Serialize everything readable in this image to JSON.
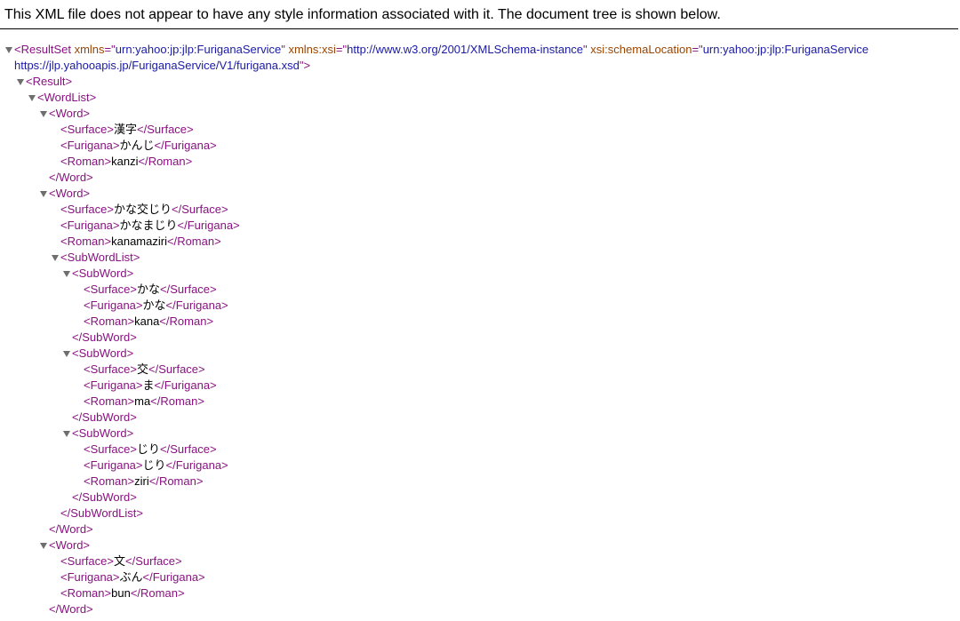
{
  "header": {
    "notice": "This XML file does not appear to have any style information associated with it. The document tree is shown below."
  },
  "root": {
    "tag": "ResultSet",
    "attrs": [
      {
        "name": "xmlns",
        "value": "urn:yahoo:jp:jlp:FuriganaService"
      },
      {
        "name": "xmlns:xsi",
        "value": "http://www.w3.org/2001/XMLSchema-instance"
      },
      {
        "name": "xsi:schemaLocation",
        "value": "urn:yahoo:jp:jlp:FuriganaService https://jlp.yahooapis.jp/FuriganaService/V1/furigana.xsd"
      }
    ]
  },
  "lines": [
    {
      "type": "open",
      "tag": "Result",
      "depth": 1,
      "toggle": true
    },
    {
      "type": "open",
      "tag": "WordList",
      "depth": 2,
      "toggle": true
    },
    {
      "type": "open",
      "tag": "Word",
      "depth": 3,
      "toggle": true
    },
    {
      "type": "leaf",
      "tag": "Surface",
      "text": "漢字",
      "depth": 4
    },
    {
      "type": "leaf",
      "tag": "Furigana",
      "text": "かんじ",
      "depth": 4
    },
    {
      "type": "leaf",
      "tag": "Roman",
      "text": "kanzi",
      "depth": 4
    },
    {
      "type": "close",
      "tag": "Word",
      "depth": 3
    },
    {
      "type": "open",
      "tag": "Word",
      "depth": 3,
      "toggle": true
    },
    {
      "type": "leaf",
      "tag": "Surface",
      "text": "かな交じり",
      "depth": 4
    },
    {
      "type": "leaf",
      "tag": "Furigana",
      "text": "かなまじり",
      "depth": 4
    },
    {
      "type": "leaf",
      "tag": "Roman",
      "text": "kanamaziri",
      "depth": 4
    },
    {
      "type": "open",
      "tag": "SubWordList",
      "depth": 4,
      "toggle": true
    },
    {
      "type": "open",
      "tag": "SubWord",
      "depth": 5,
      "toggle": true
    },
    {
      "type": "leaf",
      "tag": "Surface",
      "text": "かな",
      "depth": 6
    },
    {
      "type": "leaf",
      "tag": "Furigana",
      "text": "かな",
      "depth": 6
    },
    {
      "type": "leaf",
      "tag": "Roman",
      "text": "kana",
      "depth": 6
    },
    {
      "type": "close",
      "tag": "SubWord",
      "depth": 5
    },
    {
      "type": "open",
      "tag": "SubWord",
      "depth": 5,
      "toggle": true
    },
    {
      "type": "leaf",
      "tag": "Surface",
      "text": "交",
      "depth": 6
    },
    {
      "type": "leaf",
      "tag": "Furigana",
      "text": "ま",
      "depth": 6
    },
    {
      "type": "leaf",
      "tag": "Roman",
      "text": "ma",
      "depth": 6
    },
    {
      "type": "close",
      "tag": "SubWord",
      "depth": 5
    },
    {
      "type": "open",
      "tag": "SubWord",
      "depth": 5,
      "toggle": true
    },
    {
      "type": "leaf",
      "tag": "Surface",
      "text": "じり",
      "depth": 6
    },
    {
      "type": "leaf",
      "tag": "Furigana",
      "text": "じり",
      "depth": 6
    },
    {
      "type": "leaf",
      "tag": "Roman",
      "text": "ziri",
      "depth": 6
    },
    {
      "type": "close",
      "tag": "SubWord",
      "depth": 5
    },
    {
      "type": "close",
      "tag": "SubWordList",
      "depth": 4
    },
    {
      "type": "close",
      "tag": "Word",
      "depth": 3
    },
    {
      "type": "open",
      "tag": "Word",
      "depth": 3,
      "toggle": true
    },
    {
      "type": "leaf",
      "tag": "Surface",
      "text": "文",
      "depth": 4
    },
    {
      "type": "leaf",
      "tag": "Furigana",
      "text": "ぶん",
      "depth": 4
    },
    {
      "type": "leaf",
      "tag": "Roman",
      "text": "bun",
      "depth": 4
    },
    {
      "type": "close",
      "tag": "Word",
      "depth": 3
    }
  ],
  "colors": {
    "tag": "#881280",
    "attr_name": "#994500",
    "attr_value": "#1a1aa6",
    "toggle": "#6e6e6e"
  }
}
